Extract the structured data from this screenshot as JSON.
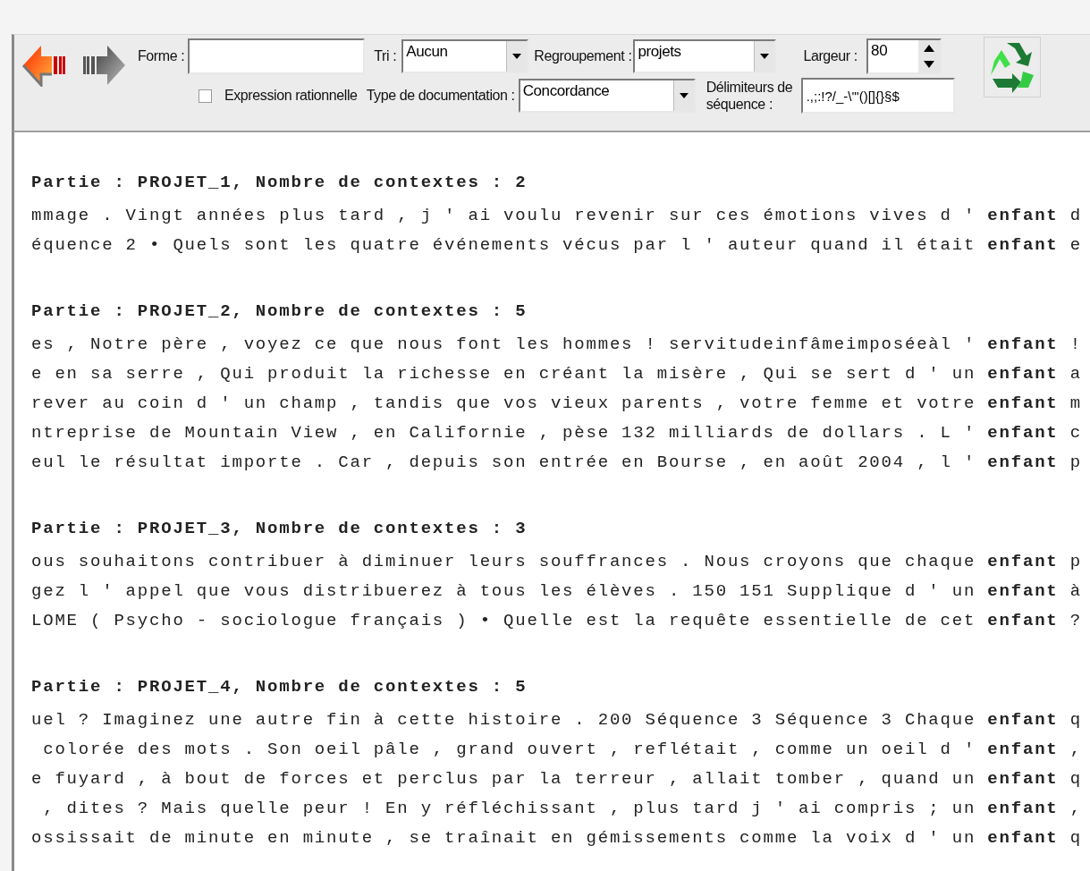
{
  "toolbar": {
    "forme": {
      "label": "Forme :"
    },
    "tri": {
      "label": "Tri :",
      "value": "Aucun"
    },
    "regroupement": {
      "label": "Regroupement :",
      "value": "projets"
    },
    "largeur": {
      "label": "Largeur :",
      "value": "80"
    },
    "regex": {
      "label": "Expression rationnelle",
      "checked": false
    },
    "type_documentation": {
      "label": "Type de documentation :",
      "value": "Concordance"
    },
    "delimiteurs": {
      "label": "Délimiteurs de séquence :",
      "value": ".,;:!?/_-\\'\"()[]{}§$"
    }
  },
  "sections": [
    {
      "header": "Partie : PROJET_1, Nombre de contextes : 2",
      "lines": [
        "mmage . Vingt années plus tard , j ' ai voulu revenir sur ces émotions vives d ' **enfant** d",
        "équence 2 • Quels sont les quatre événements vécus par l ' auteur quand il était **enfant** e"
      ]
    },
    {
      "header": "Partie : PROJET_2, Nombre de contextes : 5",
      "lines": [
        "es , Notre père , voyez ce que nous font les hommes ! servitudeinfâmeimposéeàl ' **enfant** !",
        "e en sa serre , Qui produit la richesse en créant la misère , Qui se sert d ' un **enfant** a",
        "rever au coin d ' un champ , tandis que vos vieux parents , votre femme et votre **enfant** m",
        "ntreprise de Mountain View , en Californie , pèse 132 milliards de dollars . L ' **enfant** c",
        "eul le résultat importe . Car , depuis son entrée en Bourse , en août 2004 , l ' **enfant** p"
      ]
    },
    {
      "header": "Partie : PROJET_3, Nombre de contextes : 3",
      "lines": [
        "ous souhaitons contribuer à diminuer leurs souffrances . Nous croyons que chaque **enfant** p",
        "gez l ' appel que vous distribuerez à tous les élèves . 150 151 Supplique d ' un **enfant** à",
        "LOME ( Psycho - sociologue français ) • Quelle est la requête essentielle de cet **enfant** ?"
      ]
    },
    {
      "header": "Partie : PROJET_4, Nombre de contextes : 5",
      "lines": [
        "uel ? Imaginez une autre fin à cette histoire . 200 Séquence 3 Séquence 3 Chaque **enfant** q",
        " colorée des mots . Son oeil pâle , grand ouvert , reflétait , comme un oeil d ' **enfant** ,",
        "e fuyard , à bout de forces et perclus par la terreur , allait tomber , quand un **enfant** q",
        " , dites ? Mais quelle peur ! En y réfléchissant , plus tard j ' ai compris ; un **enfant** ,",
        "ossissait de minute en minute , se traînait en gémissements comme la voix d ' un **enfant** q"
      ]
    }
  ]
}
